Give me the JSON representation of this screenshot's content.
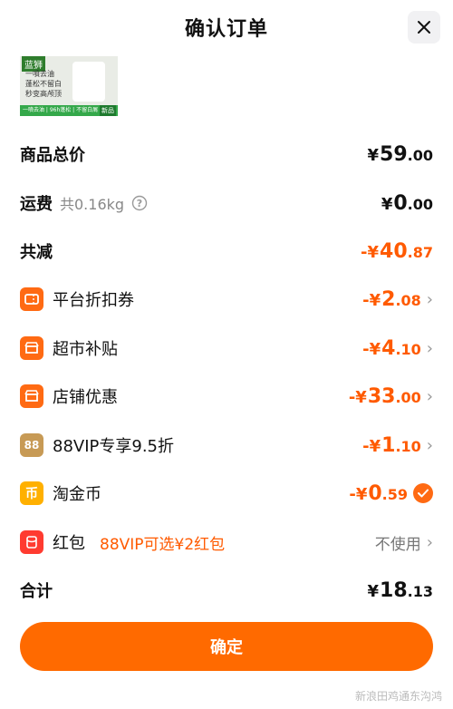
{
  "header": {
    "title": "确认订单"
  },
  "thumbnail": {
    "badge": "蓝狮",
    "text_lines": [
      "一噴去油",
      "蓬松不留白",
      "秒变高颅顶"
    ],
    "strip": "一噴去油 | 96h蓬松 | 不留白屑",
    "new_tag": "新品"
  },
  "summary": {
    "total_label": "商品总价",
    "total_currency": "¥",
    "total_int": "59",
    "total_dec": ".00",
    "shipping_label": "运费",
    "shipping_weight": "共0.16kg",
    "shipping_currency": "¥",
    "shipping_int": "0",
    "shipping_dec": ".00",
    "reduce_label": "共减",
    "reduce_currency": "-¥",
    "reduce_int": "40",
    "reduce_dec": ".87"
  },
  "discounts": [
    {
      "label": "平台折扣券",
      "currency": "-¥",
      "int": "2",
      "dec": ".08"
    },
    {
      "label": "超市补贴",
      "currency": "-¥",
      "int": "4",
      "dec": ".10"
    },
    {
      "label": "店铺优惠",
      "currency": "-¥",
      "int": "33",
      "dec": ".00"
    },
    {
      "label": "88VIP专享9.5折",
      "currency": "-¥",
      "int": "1",
      "dec": ".10",
      "icon_text": "88"
    },
    {
      "label": "淘金币",
      "currency": "-¥",
      "int": "0",
      "dec": ".59",
      "icon_text": "币"
    }
  ],
  "redpacket": {
    "label": "红包",
    "promo": "88VIP可选¥2红包",
    "status": "不使用"
  },
  "final": {
    "label": "合计",
    "currency": "¥",
    "int": "18",
    "dec": ".13"
  },
  "button": {
    "label": "确定"
  },
  "watermark": "新浪田鸡通东沟鸿"
}
